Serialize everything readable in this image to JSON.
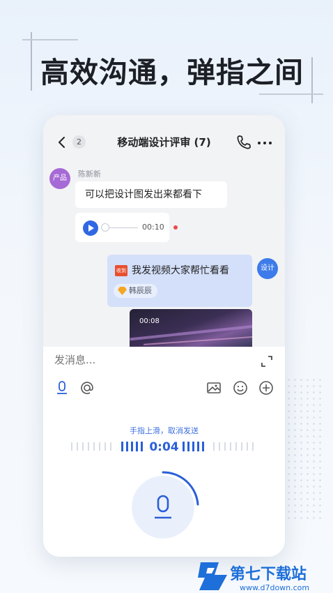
{
  "headline": "高效沟通，弹指之间",
  "chat": {
    "unread_badge": "2",
    "title": "移动端设计评审 (7)",
    "left_avatar": "产品",
    "sender_name": "陈新新",
    "message_1": "可以把设计图发出来都看下",
    "voice_duration": "00:10",
    "right_avatar": "设计",
    "received_tag": "收到",
    "message_2": "我发视频大家帮忙看看",
    "mention_name": "韩辰辰",
    "video_duration": "00:08"
  },
  "composer": {
    "placeholder": "发消息...",
    "cancel_hint": "手指上滑，取消发送",
    "timer": "0:04"
  },
  "watermark": {
    "brand": "第七下载站",
    "url": "www.d7down.com"
  },
  "colors": {
    "accent": "#3068e2",
    "unread": "#ec4a4a"
  }
}
